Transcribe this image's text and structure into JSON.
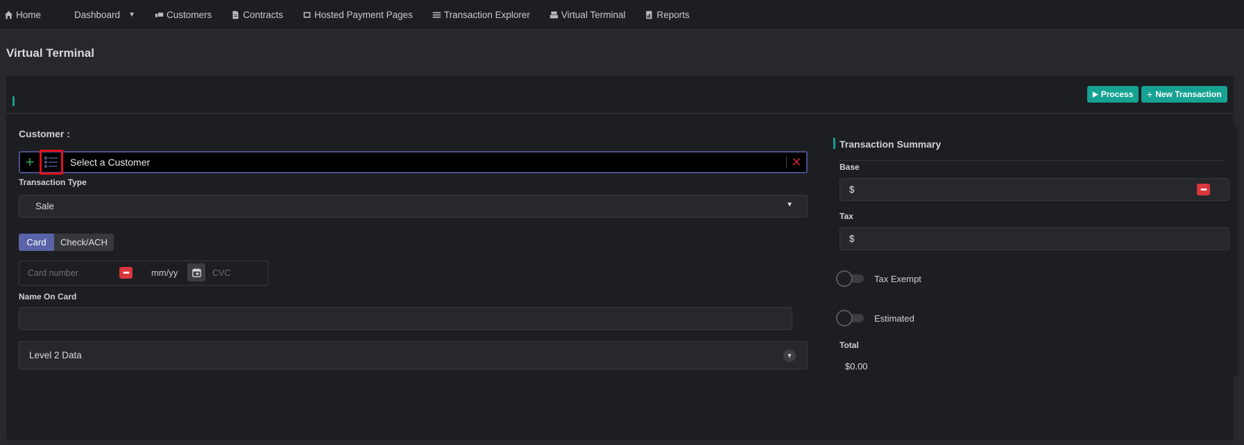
{
  "nav": {
    "items": [
      {
        "label": "Home",
        "icon": "home-icon"
      },
      {
        "label": "Dashboard",
        "icon": "dropdown-caret"
      },
      {
        "label": "Customers",
        "icon": "customers-icon"
      },
      {
        "label": "Contracts",
        "icon": "document-icon"
      },
      {
        "label": "Hosted Payment Pages",
        "icon": "pages-icon"
      },
      {
        "label": "Transaction Explorer",
        "icon": "list-icon"
      },
      {
        "label": "Virtual Terminal",
        "icon": "terminal-icon"
      },
      {
        "label": "Reports",
        "icon": "report-icon"
      }
    ]
  },
  "page": {
    "title": "Virtual Terminal"
  },
  "toolbar": {
    "process_label": "Process",
    "new_transaction_label": "New Transaction"
  },
  "form": {
    "customer_label": "Customer :",
    "customer_placeholder": "Select a Customer",
    "transaction_type_label": "Transaction Type",
    "transaction_type_value": "Sale",
    "tabs": [
      "Card",
      "Check/ACH"
    ],
    "active_tab": "Card",
    "card_number_placeholder": "Card number",
    "expiry_placeholder": "mm/yy",
    "cvc_placeholder": "CVC",
    "name_on_card_label": "Name On Card",
    "name_on_card_value": "",
    "level2_label": "Level 2 Data"
  },
  "summary": {
    "title": "Transaction Summary",
    "base_label": "Base",
    "base_prefix": "$",
    "tax_label": "Tax",
    "tax_prefix": "$",
    "tax_exempt_label": "Tax Exempt",
    "tax_exempt_on": false,
    "estimated_label": "Estimated",
    "estimated_on": false,
    "total_label": "Total",
    "total_value": "$0.00"
  },
  "colors": {
    "accent": "#15a292",
    "tab_active": "#5a63a8",
    "danger": "#d9363e",
    "add": "#2ea84b"
  }
}
